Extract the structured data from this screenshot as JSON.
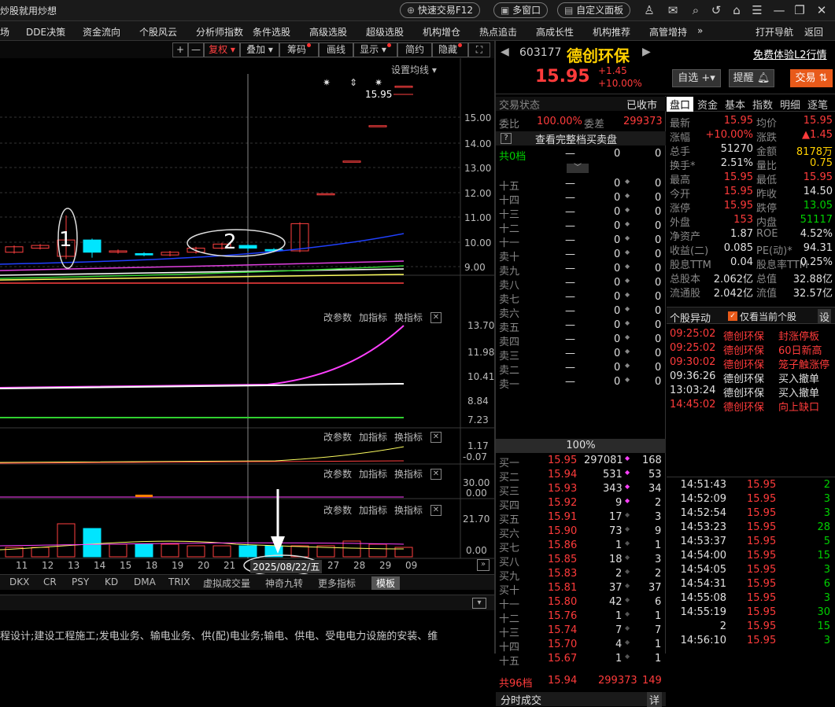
{
  "app": {
    "title": "炒股就用炒想"
  },
  "topbar": {
    "quick_trade": "快速交易F12",
    "multi_window": "多窗口",
    "custom_panel": "自定义面板"
  },
  "menubar": {
    "items": [
      "场",
      "DDE决策",
      "资金流向",
      "个股风云",
      "分析师指数",
      "条件选股",
      "高级选股",
      "超级选股",
      "机构增仓",
      "热点追击",
      "高成长性",
      "机构推荐",
      "高管增持",
      "»",
      "打开导航",
      "返回"
    ]
  },
  "chart_toolbar": {
    "plus": "+",
    "minus": "—",
    "restore_right": "复权",
    "overlay": "叠加",
    "chips": "筹码",
    "draw_line": "画线",
    "display": "显示",
    "simple": "简约",
    "hide": "隐藏"
  },
  "chart": {
    "setting_ma": "设置均线",
    "price_ticks": [
      "15.00",
      "14.00",
      "13.00",
      "12.00",
      "11.00",
      "10.00",
      "9.00"
    ],
    "last_price_label": "15.95",
    "annotations": [
      "1",
      "2"
    ],
    "date_label": "2025/08/22/五",
    "x_labels": [
      "11",
      "12",
      "13",
      "14",
      "15",
      "18",
      "19",
      "20",
      "21",
      "27",
      "28",
      "29",
      "09"
    ],
    "panels": [
      {
        "buttons": [
          "改参数",
          "加指标",
          "换指标"
        ],
        "ticks": [
          "13.70",
          "11.98",
          "10.41",
          "8.84",
          "7.23"
        ]
      },
      {
        "buttons": [
          "改参数",
          "加指标",
          "换指标"
        ],
        "ticks": [
          "1.17",
          "-0.07"
        ]
      },
      {
        "buttons": [
          "改参数",
          "加指标",
          "换指标"
        ],
        "ticks": [
          "30.00",
          "0.00"
        ]
      },
      {
        "buttons": [
          "改参数",
          "加指标",
          "换指标"
        ],
        "ticks": [
          "21.70",
          "0.00"
        ]
      }
    ]
  },
  "chart_data": {
    "type": "candlestick",
    "dates": [
      "11",
      "12",
      "13",
      "14",
      "15",
      "18",
      "19",
      "20",
      "21",
      "22",
      "25",
      "26",
      "27",
      "28",
      "29",
      "09"
    ],
    "candles": [
      {
        "o": 9.85,
        "c": 10.05,
        "h": 10.1,
        "l": 9.8
      },
      {
        "o": 10.0,
        "c": 10.1,
        "h": 10.15,
        "l": 9.95
      },
      {
        "o": 9.7,
        "c": 10.3,
        "h": 11.2,
        "l": 9.6
      },
      {
        "o": 10.3,
        "c": 9.85,
        "h": 10.35,
        "l": 9.65
      },
      {
        "o": 9.85,
        "c": 9.9,
        "h": 9.95,
        "l": 9.8
      },
      {
        "o": 9.8,
        "c": 9.75,
        "h": 9.85,
        "l": 9.7
      },
      {
        "o": 9.75,
        "c": 9.85,
        "h": 9.9,
        "l": 9.7
      },
      {
        "o": 9.85,
        "c": 10.0,
        "h": 10.05,
        "l": 9.8
      },
      {
        "o": 10.0,
        "c": 10.15,
        "h": 10.2,
        "l": 9.95
      },
      {
        "o": 10.1,
        "c": 10.0,
        "h": 10.15,
        "l": 9.9
      },
      {
        "o": 9.95,
        "c": 9.9,
        "h": 10.0,
        "l": 9.85
      },
      {
        "o": 9.9,
        "c": 10.9,
        "h": 10.95,
        "l": 9.85
      },
      {
        "o": 12.0,
        "c": 12.0,
        "h": 12.0,
        "l": 12.0
      },
      {
        "o": 13.2,
        "c": 13.2,
        "h": 13.2,
        "l": 13.2
      },
      {
        "o": 14.5,
        "c": 14.5,
        "h": 14.5,
        "l": 14.5
      },
      {
        "o": 15.95,
        "c": 15.95,
        "h": 15.95,
        "l": 15.95
      }
    ],
    "ylim": [
      8.6,
      16.4
    ]
  },
  "bottom_tabs": [
    "DKX",
    "CR",
    "PSY",
    "KD",
    "DMA",
    "TRIX",
    "虚拟成交量",
    "神奇九转",
    "更多指标",
    "模板"
  ],
  "company_text": "程设计;建设工程施工;发电业务、输电业务、供(配)电业务;输电、供电、受电电力设施的安装、维",
  "stock": {
    "code": "603177",
    "name": "德创环保",
    "price": "15.95",
    "change": "+1.45",
    "change_pct": "+10.00%",
    "l2": "免费体验L2行情",
    "fav": "自选",
    "alert": "提醒",
    "trade": "交易"
  },
  "order_book": {
    "status_label": "交易状态",
    "status_value": "已收市",
    "weibi_label": "委比",
    "weibi_value": "100.00%",
    "weicha_label": "委差",
    "weicha_value": "299373",
    "view_all": "查看完整档买卖盘",
    "total_label": "共0档",
    "total_dash": "—",
    "total_vol": "0",
    "total_cnt": "0",
    "center_pct": "100%",
    "sells": [
      [
        "十五",
        "—",
        "0",
        "0"
      ],
      [
        "十四",
        "—",
        "0",
        "0"
      ],
      [
        "十三",
        "—",
        "0",
        "0"
      ],
      [
        "十二",
        "—",
        "0",
        "0"
      ],
      [
        "十一",
        "—",
        "0",
        "0"
      ],
      [
        "卖十",
        "—",
        "0",
        "0"
      ],
      [
        "卖九",
        "—",
        "0",
        "0"
      ],
      [
        "卖八",
        "—",
        "0",
        "0"
      ],
      [
        "卖七",
        "—",
        "0",
        "0"
      ],
      [
        "卖六",
        "—",
        "0",
        "0"
      ],
      [
        "卖五",
        "—",
        "0",
        "0"
      ],
      [
        "卖四",
        "—",
        "0",
        "0"
      ],
      [
        "卖三",
        "—",
        "0",
        "0"
      ],
      [
        "卖二",
        "—",
        "0",
        "0"
      ],
      [
        "卖一",
        "—",
        "0",
        "0"
      ]
    ],
    "buys": [
      [
        "买一",
        "15.95",
        "297081",
        "168"
      ],
      [
        "买二",
        "15.94",
        "531",
        "53"
      ],
      [
        "买三",
        "15.93",
        "343",
        "34"
      ],
      [
        "买四",
        "15.92",
        "9",
        "2"
      ],
      [
        "买五",
        "15.91",
        "17",
        "3"
      ],
      [
        "买六",
        "15.90",
        "73",
        "9"
      ],
      [
        "买七",
        "15.86",
        "1",
        "1"
      ],
      [
        "买八",
        "15.85",
        "18",
        "3"
      ],
      [
        "买九",
        "15.83",
        "2",
        "2"
      ],
      [
        "买十",
        "15.81",
        "37",
        "37"
      ],
      [
        "十一",
        "15.80",
        "42",
        "6"
      ],
      [
        "十二",
        "15.76",
        "1",
        "1"
      ],
      [
        "十三",
        "15.74",
        "7",
        "7"
      ],
      [
        "十四",
        "15.70",
        "4",
        "1"
      ],
      [
        "十五",
        "15.67",
        "1",
        "1"
      ]
    ],
    "bottom_total": [
      "共96档",
      "15.94",
      "299373",
      "149"
    ],
    "fenshi": "分时成交",
    "detail": "详"
  },
  "info_tabs": [
    "盘口",
    "资金",
    "基本",
    "指数",
    "明细",
    "逐笔"
  ],
  "info": [
    [
      "最新",
      "15.95",
      "均价",
      "15.95"
    ],
    [
      "涨幅",
      "+10.00%",
      "涨跌",
      "▲1.45"
    ],
    [
      "总手",
      "51270",
      "金额",
      "8178万"
    ],
    [
      "换手*",
      "2.51%",
      "量比",
      "0.75"
    ],
    [
      "最高",
      "15.95",
      "最低",
      "15.95"
    ],
    [
      "今开",
      "15.95",
      "昨收",
      "14.50"
    ],
    [
      "涨停",
      "15.95",
      "跌停",
      "13.05"
    ],
    [
      "外盘",
      "153",
      "内盘",
      "51117"
    ],
    [
      "净资产",
      "1.87",
      "ROE",
      "4.52%"
    ],
    [
      "收益(二)",
      "0.085",
      "PE(动)*",
      "94.31"
    ],
    [
      "股息TTM",
      "0.04",
      "股息率TTM",
      "0.25%"
    ],
    [
      "总股本",
      "2.062亿",
      "总值",
      "32.88亿"
    ],
    [
      "流通股",
      "2.042亿",
      "流值",
      "32.57亿"
    ]
  ],
  "anomaly": {
    "title": "个股异动",
    "only_current": "仅看当前个股",
    "settings": "设",
    "rows": [
      [
        "09:25:02",
        "德创环保",
        "封涨停板"
      ],
      [
        "09:25:02",
        "德创环保",
        "60日新高"
      ],
      [
        "09:30:02",
        "德创环保",
        "笼子触涨停"
      ],
      [
        "09:36:26",
        "德创环保",
        "买入撤单"
      ],
      [
        "13:03:24",
        "德创环保",
        "买入撤单"
      ],
      [
        "14:45:02",
        "德创环保",
        "向上缺口"
      ]
    ]
  },
  "ticks": [
    [
      "14:51:43",
      "15.95",
      "2"
    ],
    [
      "14:52:09",
      "15.95",
      "3"
    ],
    [
      "14:52:54",
      "15.95",
      "3"
    ],
    [
      "14:53:23",
      "15.95",
      "28"
    ],
    [
      "14:53:37",
      "15.95",
      "5"
    ],
    [
      "14:54:00",
      "15.95",
      "15"
    ],
    [
      "14:54:05",
      "15.95",
      "3"
    ],
    [
      "14:54:31",
      "15.95",
      "6"
    ],
    [
      "14:55:08",
      "15.95",
      "3"
    ],
    [
      "14:55:19",
      "15.95",
      "30"
    ],
    [
      "2",
      "15.95",
      "15"
    ],
    [
      "14:56:10",
      "15.95",
      "3"
    ]
  ]
}
